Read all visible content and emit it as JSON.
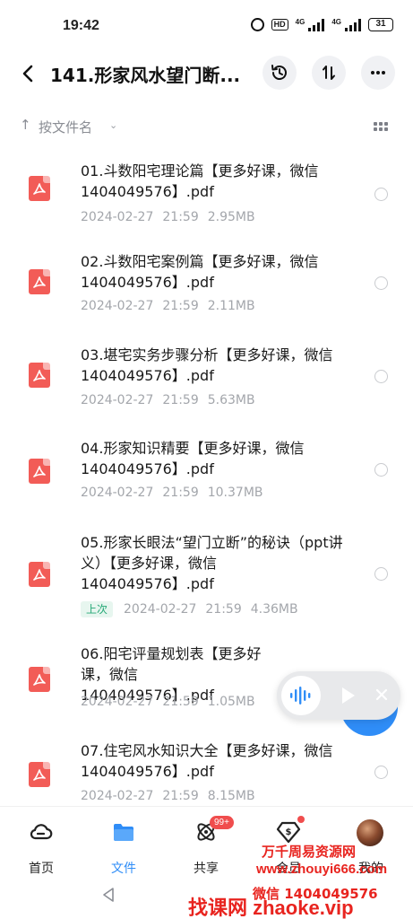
{
  "status_bar": {
    "time": "19:42",
    "hd_label": "HD",
    "net_label_1": "4G",
    "net_label_2": "4G",
    "battery": "31"
  },
  "nav": {
    "title": "141.形家风水望门断..."
  },
  "sort": {
    "label": "按文件名"
  },
  "files": [
    {
      "name": "01.斗数阳宅理论篇【更多好课，微信1404049576】.pdf",
      "date": "2024-02-27",
      "time": "21:59",
      "size": "2.95MB"
    },
    {
      "name": "02.斗数阳宅案例篇【更多好课，微信1404049576】.pdf",
      "date": "2024-02-27",
      "time": "21:59",
      "size": "2.11MB"
    },
    {
      "name": "03.堪宅实务步骤分析【更多好课，微信1404049576】.pdf",
      "date": "2024-02-27",
      "time": "21:59",
      "size": "5.63MB"
    },
    {
      "name": "04.形家知识精要【更多好课，微信1404049576】.pdf",
      "date": "2024-02-27",
      "time": "21:59",
      "size": "10.37MB"
    },
    {
      "name": "05.形家长眼法“望门立断”的秘诀（ppt讲义）【更多好课，微信1404049576】.pdf",
      "tag": "上次",
      "date": "2024-02-27",
      "time": "21:59",
      "size": "4.36MB"
    },
    {
      "name": "06.阳宅评量规划表【更多好课，微信1404049576】.pdf",
      "date": "2024-02-27",
      "time": "21:59",
      "size": "1.05MB"
    },
    {
      "name": "07.住宅风水知识大全【更多好课，微信1404049576】.pdf",
      "date": "2024-02-27",
      "time": "21:59",
      "size": "8.15MB"
    }
  ],
  "tabs": [
    {
      "label": "首页",
      "icon": "cloud-icon"
    },
    {
      "label": "文件",
      "icon": "folder-icon"
    },
    {
      "label": "共享",
      "icon": "share-icon",
      "badge": "99+"
    },
    {
      "label": "会员",
      "icon": "vip-icon"
    },
    {
      "label": "我的",
      "icon": "avatar"
    }
  ],
  "watermark": {
    "line1": "万千周易资源网",
    "line2": "www.zhouyi666.com",
    "line3": "微信 1404049576",
    "line4": "找课网 zhaoke.vip"
  },
  "colors": {
    "accent": "#2f8df7",
    "pdf": "#f25c57",
    "badge": "#f04d4d",
    "last_tag": "#25a876",
    "watermark": "#e8241f"
  }
}
